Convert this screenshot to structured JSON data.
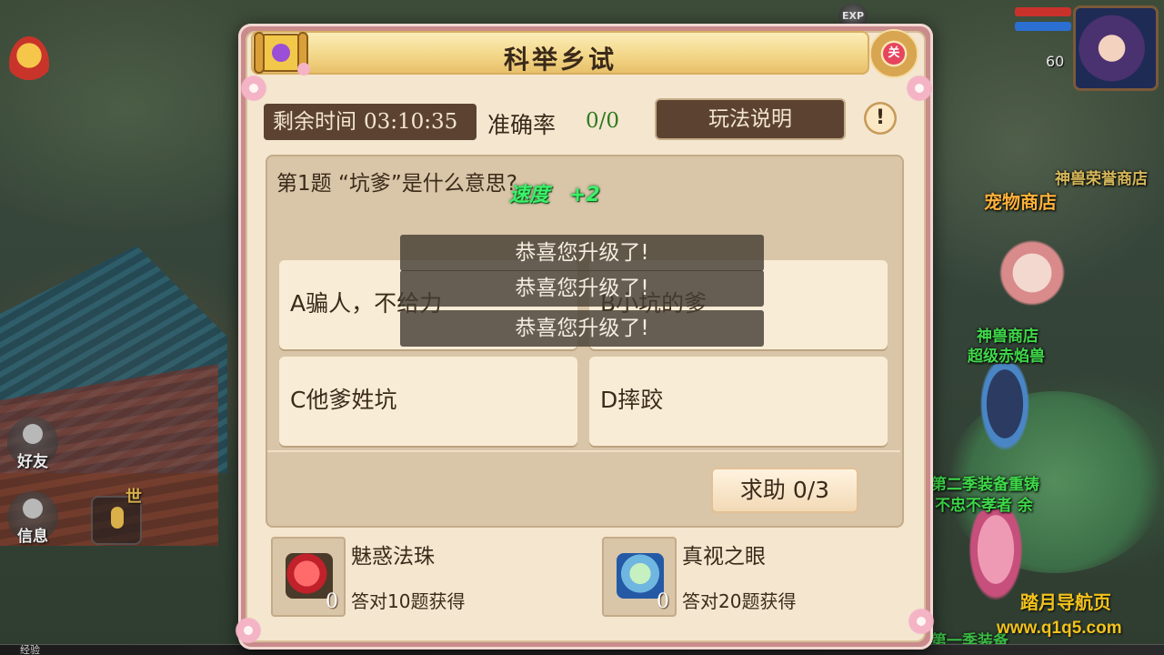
{
  "dialog": {
    "title": "科举乡试",
    "close_label": "关",
    "timer_label": "剩余时间",
    "timer_value": "03:10:35",
    "accuracy_label": "准确率",
    "accuracy_value": "0/0",
    "rules_button": "玩法说明",
    "info_button": "!"
  },
  "question": {
    "text": "第1题  “坑爹”是什么意思?",
    "options": [
      {
        "label": "A骗人，不给力"
      },
      {
        "label": "B小坑的爹"
      },
      {
        "label": "C他爹姓坑"
      },
      {
        "label": "D摔跤"
      }
    ],
    "help_button": "求助 0/3"
  },
  "popup": {
    "speed_label": "速度",
    "speed_bonus": "+2",
    "toasts": [
      "恭喜您升级了!",
      "恭喜您升级了!",
      "恭喜您升级了!"
    ]
  },
  "rewards": [
    {
      "name": "魅惑法珠",
      "condition": "答对10题获得",
      "count": "0",
      "icon": "heart-orb-icon"
    },
    {
      "name": "真视之眼",
      "condition": "答对20题获得",
      "count": "0",
      "icon": "eye-bowl-icon"
    }
  ],
  "hud": {
    "player_level": "60",
    "exp_badge": "EXP",
    "friends_label": "好友",
    "messages_label": "信息",
    "world_tag": "世",
    "exp_bar_label": "经验"
  },
  "scene_labels": {
    "beast_shop_top": "神兽荣誉商店",
    "pet_shop": "宠物商店",
    "god_beast_shop": "神兽商店",
    "super_beast": "超级赤焰兽",
    "gear_recast": "第二季装备重铸",
    "unfilial": "不忠不孝者  余",
    "bottom_label": "第一季装备"
  },
  "watermark": {
    "title": "踏月导航页",
    "url": "www.q1q5.com"
  },
  "colors": {
    "panel_bg": "#f4e6cf",
    "dark_brown": "#5c4331",
    "accuracy_green": "#2f7a20",
    "speed_green": "#3cf06a",
    "watermark_gold": "#f2c21c"
  }
}
